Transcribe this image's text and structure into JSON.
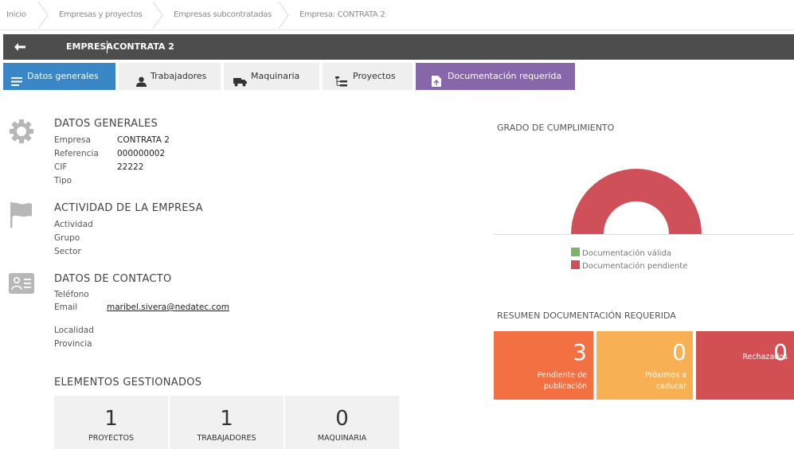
{
  "breadcrumb": [
    "Inicio",
    "Empresas y proyectos",
    "Empresas subcontratadas",
    "Empresa: CONTRATA 2"
  ],
  "header": {
    "label": "EMPRESA",
    "value": "CONTRATA 2"
  },
  "tabs": [
    {
      "label": "Datos generales",
      "icon": "list-icon"
    },
    {
      "label": "Trabajadores",
      "icon": "user-icon"
    },
    {
      "label": "Maquinaria",
      "icon": "truck-icon"
    },
    {
      "label": "Proyectos",
      "icon": "tree-icon"
    },
    {
      "label": "Documentación requerida",
      "icon": "document-icon"
    }
  ],
  "datos_generales": {
    "title": "DATOS GENERALES",
    "fields": [
      {
        "label": "Empresa",
        "value": "CONTRATA 2"
      },
      {
        "label": "Referencia",
        "value": "000000002"
      },
      {
        "label": "CIF",
        "value": "22222"
      },
      {
        "label": "Tipo",
        "value": ""
      }
    ]
  },
  "actividad": {
    "title": "ACTIVIDAD DE LA EMPRESA",
    "fields": [
      {
        "label": "Actividad",
        "value": ""
      },
      {
        "label": "Grupo",
        "value": ""
      },
      {
        "label": "Sector",
        "value": ""
      }
    ]
  },
  "contacto": {
    "title": "DATOS DE CONTACTO",
    "fields": [
      {
        "label": "Teléfono",
        "value": ""
      },
      {
        "label": "Email",
        "value": "maribel.sivera@nedatec.com"
      },
      {
        "label": "Localidad",
        "value": ""
      },
      {
        "label": "Provincia",
        "value": ""
      }
    ]
  },
  "elementos": {
    "title": "ELEMENTOS GESTIONADOS",
    "items": [
      {
        "value": "1",
        "label": "PROYECTOS"
      },
      {
        "value": "1",
        "label": "TRABAJADORES"
      },
      {
        "value": "0",
        "label": "MAQUINARIA"
      }
    ]
  },
  "cumplimiento": {
    "title": "GRADO DE CUMPLIMIENTO",
    "legend": [
      {
        "label": "Documentación válida",
        "color": "#7cb36b"
      },
      {
        "label": "Documentación pendiente",
        "color": "#d0505a"
      }
    ],
    "valid_fraction": 0
  },
  "resumen": {
    "title": "RESUMEN DOCUMENTACIÓN REQUERIDA",
    "cards": [
      {
        "value": "3",
        "line1": "Pendiente de",
        "line2": "publicación",
        "color": "#f37043"
      },
      {
        "value": "0",
        "line1": "Próximos a",
        "line2": "caducar",
        "color": "#f7b154"
      },
      {
        "value": "0",
        "line1": "Rechazados",
        "line2": "",
        "color": "#d25054"
      }
    ]
  },
  "colors": {
    "tab_active": "#3a87c7",
    "tab_docs": "#8767a9",
    "titlebar": "#4d4d4d"
  }
}
